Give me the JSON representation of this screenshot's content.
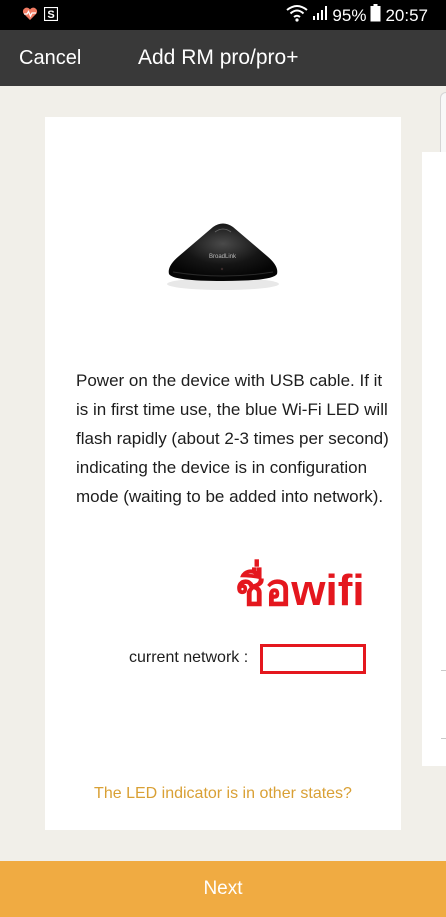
{
  "status_bar": {
    "battery_percent": "95%",
    "time": "20:57",
    "icons": [
      "health-heart-icon",
      "s-app-icon",
      "wifi-icon",
      "signal-icon",
      "battery-icon"
    ]
  },
  "header": {
    "cancel_label": "Cancel",
    "title": "Add RM pro/pro+"
  },
  "content": {
    "instructions": "Power on the device with USB cable. If it is in first time use, the blue Wi-Fi LED will flash rapidly (about 2-3 times per second) indicating the device is in configuration mode (waiting to be added into network).",
    "annotation_thai": "ชื่อwifi",
    "current_network_label": "current network :",
    "current_network_value": "",
    "led_link": "The LED indicator is in other states?"
  },
  "device_brand": "BroadLink",
  "footer": {
    "next_label": "Next"
  },
  "colors": {
    "header_bg": "#393939",
    "page_bg": "#f1efe9",
    "accent_orange": "#f0ab42",
    "link_gold": "#d9a035",
    "annotation_red": "#e4171e"
  }
}
